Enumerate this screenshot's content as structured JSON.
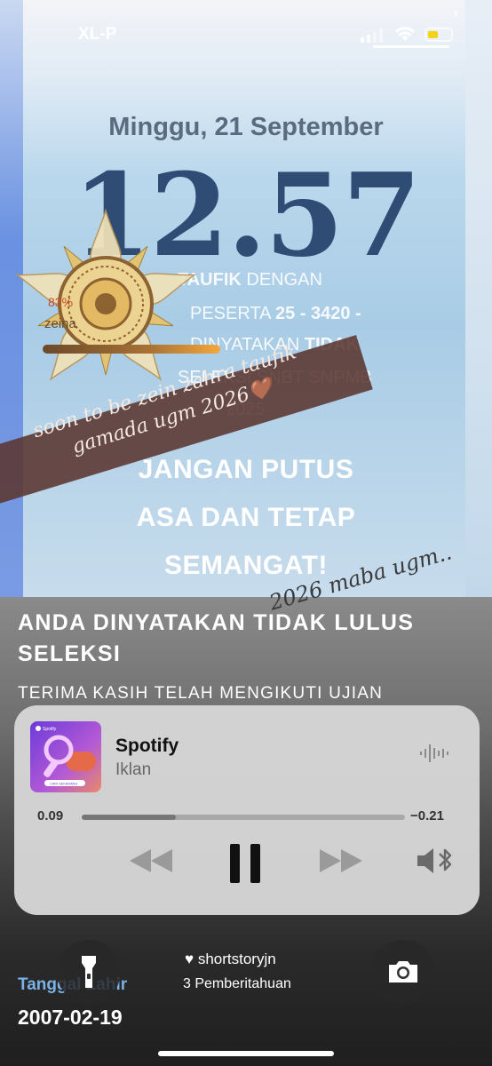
{
  "status": {
    "carrier": "XL-P"
  },
  "lock": {
    "date": "Minggu, 21 September",
    "time": "12.57"
  },
  "wallpaper_text": {
    "line1_prefix": "",
    "line1_bold": "TAUFIK",
    "line1_rest": " DENGAN",
    "line2_prefix": "PESERTA ",
    "line2_bold": "25 - 3420 -",
    "line3_prefix": "DINYATAKAN ",
    "line3_bold": "TIDAK",
    "line4": "SELEKSI SNBT SNPMB",
    "line5": "2025",
    "big1": "JANGAN PUTUS",
    "big2": "ASA DAN TETAP",
    "big3": "SEMANGAT!",
    "percent": "83%",
    "zein_label": "zeina"
  },
  "sticker": {
    "line1": "soon to be zein zahra taufik",
    "line2": "gamada ugm 2026🤎",
    "maba": "2026 maba ugm.."
  },
  "notification": {
    "title": "ANDA DINYATAKAN TIDAK LULUS SELEKSI",
    "body": "TERIMA KASIH TELAH MENGIKUTI UJIAN"
  },
  "player": {
    "app": "Spotify",
    "subtitle": "Iklan",
    "elapsed": "0.09",
    "remaining": "−0.21",
    "progress": 0.29,
    "art_label": "Spotify",
    "art_button": "CARI SEKARANG"
  },
  "lockscreen_bottom": {
    "tanggal_label": "Tanggal Lahir",
    "tanggal_value": "2007-02-19",
    "owner": "shortstoryjn",
    "notif_count": "3 Pemberitahuan"
  }
}
